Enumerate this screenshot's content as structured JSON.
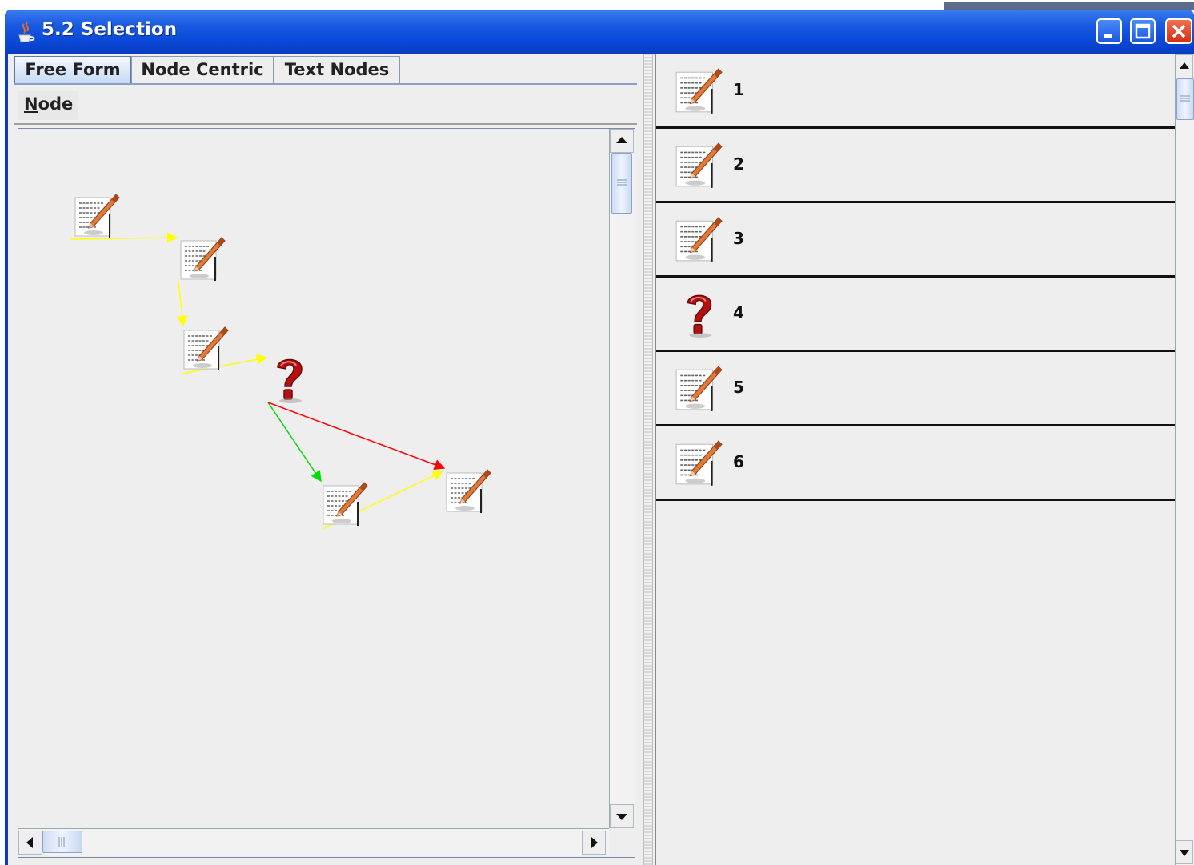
{
  "window": {
    "title": "5.2 Selection",
    "icons": [
      "java-cup-icon",
      "minimize-icon",
      "maximize-icon",
      "close-icon"
    ]
  },
  "tabs": [
    {
      "label": "Free Form",
      "selected": true
    },
    {
      "label": "Node Centric",
      "selected": false
    },
    {
      "label": "Text Nodes",
      "selected": false
    }
  ],
  "toolbar": {
    "node_menu": "Node"
  },
  "graph": {
    "nodes": [
      {
        "id": "1",
        "icon": "text-document-icon"
      },
      {
        "id": "2",
        "icon": "text-document-icon"
      },
      {
        "id": "3",
        "icon": "text-document-icon"
      },
      {
        "id": "4",
        "icon": "question-mark-icon"
      },
      {
        "id": "5",
        "icon": "text-document-icon"
      },
      {
        "id": "6",
        "icon": "text-document-icon"
      }
    ],
    "edges": [
      {
        "from": "1",
        "to": "2",
        "color": "#ffff00"
      },
      {
        "from": "2",
        "to": "3",
        "color": "#ffff00"
      },
      {
        "from": "3",
        "to": "4",
        "color": "#ffff00"
      },
      {
        "from": "4",
        "to": "5",
        "color": "#00dd00"
      },
      {
        "from": "4",
        "to": "6",
        "color": "#ff0000"
      },
      {
        "from": "5",
        "to": "6",
        "color": "#ffff00"
      }
    ]
  },
  "list": {
    "items": [
      {
        "label": "1",
        "icon": "text-document-icon"
      },
      {
        "label": "2",
        "icon": "text-document-icon"
      },
      {
        "label": "3",
        "icon": "text-document-icon"
      },
      {
        "label": "4",
        "icon": "question-mark-icon"
      },
      {
        "label": "5",
        "icon": "text-document-icon"
      },
      {
        "label": "6",
        "icon": "text-document-icon"
      }
    ]
  },
  "colors": {
    "titlebar": "#0a48d8",
    "panel_bg": "#eeeeee",
    "edge_yellow": "#ffff00",
    "edge_green": "#00dd00",
    "edge_red": "#ff0000"
  }
}
